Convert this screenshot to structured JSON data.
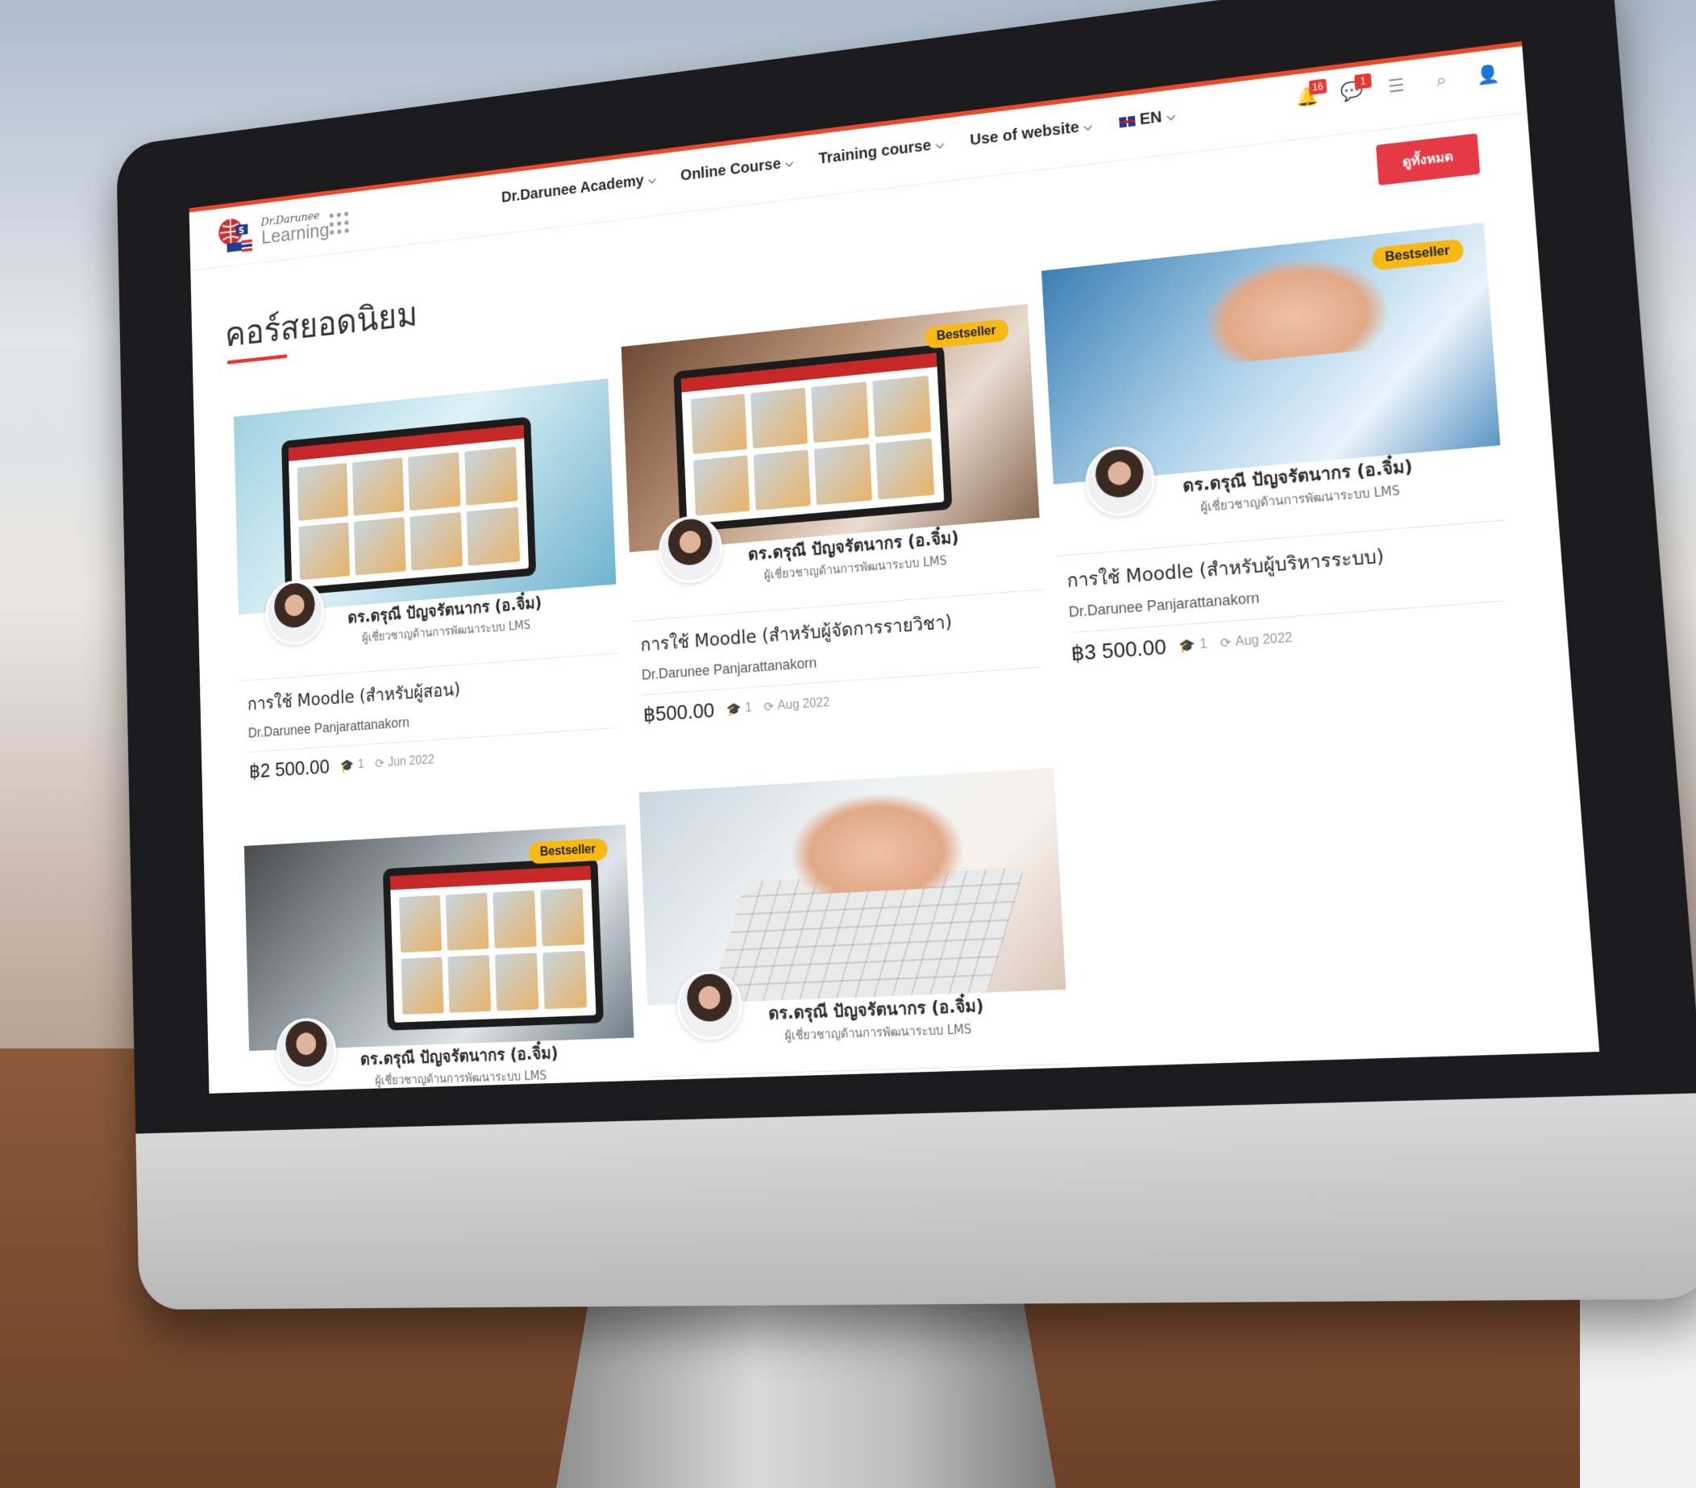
{
  "brand": {
    "logo_top": "Dr.Darunee",
    "logo_bottom": "Learning"
  },
  "nav": [
    {
      "label": "Dr.Darunee Academy"
    },
    {
      "label": "Online Course"
    },
    {
      "label": "Training course"
    },
    {
      "label": "Use of website"
    },
    {
      "label": "EN"
    }
  ],
  "toolbar": {
    "notifications_count": "16",
    "messages_count": "1"
  },
  "icons": {
    "apps": "apps-grid-icon",
    "bell": "bell-icon",
    "chat": "chat-icon",
    "settings": "sliders-icon",
    "search": "search-icon",
    "user": "user-icon",
    "enrolled": "graduation-cap-icon",
    "updated": "refresh-icon"
  },
  "colors": {
    "accent": "#e53945",
    "badge": "#f7b916",
    "top_gradient_start": "#e84a2b",
    "top_gradient_end": "#f6a623"
  },
  "view_all_label": "ดูทั้งหมด",
  "section_title": "คอร์สยอดนิยม",
  "courses": [
    {
      "bestseller": "",
      "author_name": "ดร.ดรุณี ปัญจรัตนากร (อ.จิ๋ม)",
      "author_role": "ผู้เชี่ยวชาญด้านการพัฒนาระบบ LMS",
      "title": "การใช้ Moodle (สำหรับผู้สอน)",
      "author": "Dr.Darunee Panjarattanakorn",
      "price": "฿2 500.00",
      "enrolled": "1",
      "updated": "Jun 2022"
    },
    {
      "bestseller": "Bestseller",
      "author_name": "ดร.ดรุณี ปัญจรัตนากร (อ.จิ๋ม)",
      "author_role": "ผู้เชี่ยวชาญด้านการพัฒนาระบบ LMS",
      "title": "การใช้ Moodle (สำหรับผู้จัดการรายวิชา)",
      "author": "Dr.Darunee Panjarattanakorn",
      "price": "฿500.00",
      "enrolled": "1",
      "updated": "Aug 2022"
    },
    {
      "bestseller": "Bestseller",
      "author_name": "ดร.ดรุณี ปัญจรัตนากร (อ.จิ๋ม)",
      "author_role": "ผู้เชี่ยวชาญด้านการพัฒนาระบบ LMS",
      "title": "การใช้ Moodle (สำหรับผู้บริหารระบบ)",
      "author": "Dr.Darunee Panjarattanakorn",
      "price": "฿3 500.00",
      "enrolled": "1",
      "updated": "Aug 2022"
    },
    {
      "bestseller": "Bestseller",
      "author_name": "ดร.ดรุณี ปัญจรัตนากร (อ.จิ๋ม)",
      "author_role": "ผู้เชี่ยวชาญด้านการพัฒนาระบบ LMS"
    },
    {
      "bestseller": "",
      "author_name": "ดร.ดรุณี ปัญจรัตนากร (อ.จิ๋ม)",
      "author_role": "ผู้เชี่ยวชาญด้านการพัฒนาระบบ LMS"
    }
  ]
}
